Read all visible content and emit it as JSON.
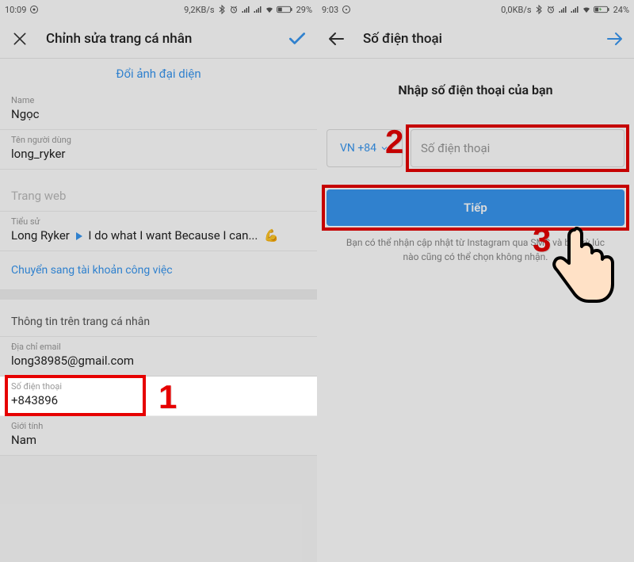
{
  "left": {
    "status": {
      "time": "10:09",
      "net": "9,2KB/s",
      "battery": "29%"
    },
    "header": {
      "title": "Chỉnh sửa trang cá nhân"
    },
    "change_avatar": "Đổi ảnh đại diện",
    "fields": {
      "name_label": "Name",
      "name_value": "Ngọc",
      "username_label": "Tên người dùng",
      "username_value": "long_ryker",
      "website_placeholder": "Trang web",
      "bio_label": "Tiểu sử",
      "bio_prefix": "Long Ryker",
      "bio_rest": "I do what I want Because I can...",
      "switch_link": "Chuyển sang tài khoản công việc",
      "section_title": "Thông tin trên trang cá nhân",
      "email_label": "Địa chỉ email",
      "email_value": "long38985@gmail.com",
      "phone_label": "Số điện thoại",
      "phone_value": "+843896",
      "gender_label": "Giới tính",
      "gender_value": "Nam"
    },
    "step1": "1"
  },
  "right": {
    "status": {
      "time": "9:03",
      "net": "0,0KB/s",
      "battery": "24%"
    },
    "header": {
      "title": "Số điện thoại"
    },
    "instruction": "Nhập số điện thoại của bạn",
    "country": "VN +84",
    "phone_placeholder": "Số điện thoại",
    "continue": "Tiếp",
    "disclaimer": "Bạn có thể nhận cập nhật từ Instagram qua SMS và bất kỳ lúc nào cũng có thể chọn không nhận.",
    "step2": "2",
    "step3": "3"
  }
}
